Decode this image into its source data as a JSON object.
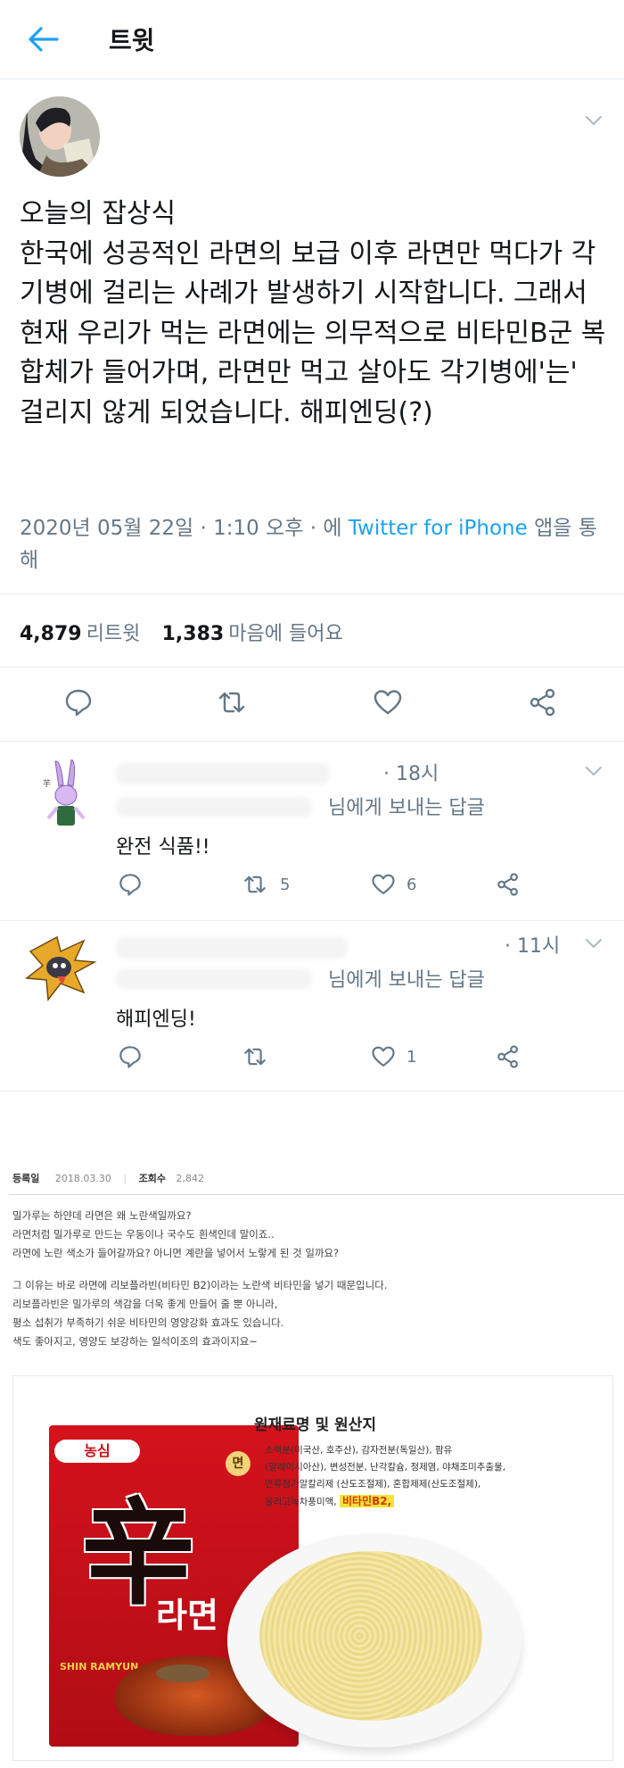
{
  "header": {
    "title": "트윗"
  },
  "tweet": {
    "text": "오늘의 잡상식\n한국에 성공적인 라면의 보급 이후 라면만 먹다가 각기병에 걸리는 사례가 발생하기 시작합니다. 그래서 현재 우리가 먹는 라면에는 의무적으로 비타민B군 복합체가 들어가며, 라면만 먹고 살아도 각기병에'는' 걸리지 않게 되었습니다. 해피엔딩(?)",
    "date": "2020년 05월 22일 · 1:10 오후 · 에 ",
    "source": "Twitter for iPhone",
    "via": " 앱을 통해",
    "retweets_count": "4,879",
    "retweets_label": "리트윗",
    "likes_count": "1,383",
    "likes_label": "마음에 들어요"
  },
  "replies": [
    {
      "time": "· 18시",
      "reply_to": "님에게 보내는 답글",
      "text": "완전 식품!!",
      "retweets": "5",
      "likes": "6"
    },
    {
      "time": "· 11시",
      "reply_to": "님에게 보내는 답글",
      "text": "해피엔딩!",
      "retweets": "",
      "likes": "1"
    }
  ],
  "blog": {
    "reg_label": "등록일",
    "reg_date": "2018.03.30",
    "views_label": "조회수",
    "views": "2,842",
    "para1": [
      "밀가루는 하얀데 라면은 왜 노란색일까요?",
      "라면처럼 밀가루로 만드는 우동이나 국수도 흰색인데 말이죠..",
      "라면에 노란 색소가 들어갈까요? 아니면 계란을 넣어서 노랗게 된 것 일까요?"
    ],
    "para2": [
      "그 이유는 바로  라면에 리보플라빈(비타민 B2)이라는 노란색 비타민을 넣기 때문입니다.",
      "리보플라빈은 밀가루의 색감을 더욱 좋게 만들어 줄 뿐 아니라,",
      "평소 섭취가 부족하기 쉬운 비타민의 영양강화 효과도 있습니다.",
      "색도 좋아지고, 영양도 보강하는 일석이조의 효과이지요~"
    ]
  },
  "ad": {
    "brand": "농심",
    "name_big": "辛",
    "name_small": "라면",
    "name_en": "SHIN RAMYUN",
    "ingredients_title": "원재료명 및 원산지",
    "noodle_label": "면",
    "ingredients_lines": [
      "소맥분(미국산, 호주산), 감자전분(독일산), 팜유",
      "(말레이시아산), 변성전분, 난각칼슘, 정제염, 야채조미추출물,",
      "면류첨가알칼리제 (산도조절제), 혼합제제(산도조절제),",
      "올리고녹차풍미액, "
    ],
    "vitamin": "비타민B2,"
  },
  "colors": {
    "accent": "#1da1f2",
    "text": "#14171a",
    "muted": "#657786",
    "divider": "#e6ecf0",
    "package_red": "#c8101a"
  }
}
